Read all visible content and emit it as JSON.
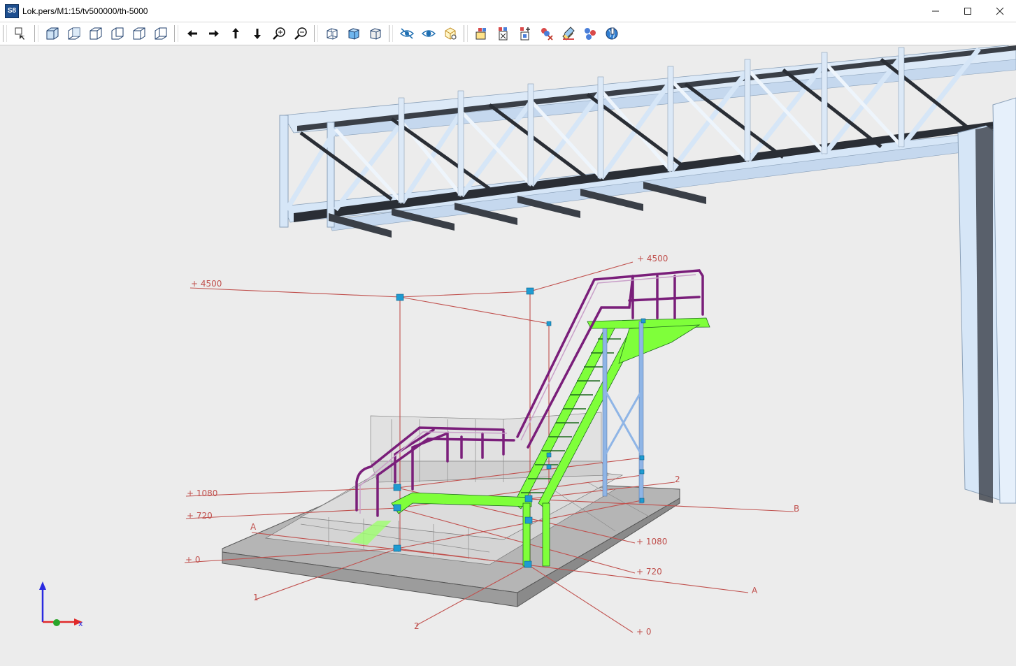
{
  "window": {
    "app_icon_text": "S8",
    "title": "Lok.pers/M1:15/tv500000/th-5000",
    "controls": [
      "minimize",
      "maximize",
      "close"
    ]
  },
  "toolbar": {
    "groups": [
      [
        "select-orbit-icon"
      ],
      [
        "view-iso-1-icon",
        "view-iso-2-icon",
        "view-iso-3-icon",
        "view-iso-4-icon",
        "view-iso-5-icon",
        "view-iso-6-icon"
      ],
      [
        "pan-left-icon",
        "pan-right-icon",
        "pan-up-icon",
        "pan-down-icon",
        "zoom-in-icon",
        "zoom-out-icon"
      ],
      [
        "wireframe-icon",
        "shaded-icon",
        "hidden-line-icon"
      ],
      [
        "hide-icon",
        "show-icon",
        "isolate-icon"
      ],
      [
        "layer-open-icon",
        "layer-export-icon",
        "layer-add-icon",
        "layer-remove-icon",
        "layer-edit-icon",
        "layer-group-icon",
        "settings-globe-icon"
      ]
    ]
  },
  "annotations": {
    "left_levels": [
      "+ 4500",
      "+ 1080",
      "+ 720",
      "+ 0"
    ],
    "right_levels": [
      "+ 4500",
      "+ 1080",
      "+ 720",
      "+ 0"
    ],
    "axis_labels": [
      "A",
      "B",
      "A",
      "1",
      "2",
      "2"
    ]
  },
  "colors": {
    "annotation": "#c0504d",
    "node": "#1f9bd1",
    "stair_stringer": "#7fff3a",
    "railing": "#7a1e7a",
    "steel": "#d6e6f7",
    "steel_dark": "#2a2e35",
    "slab": "#c9c9c9"
  }
}
